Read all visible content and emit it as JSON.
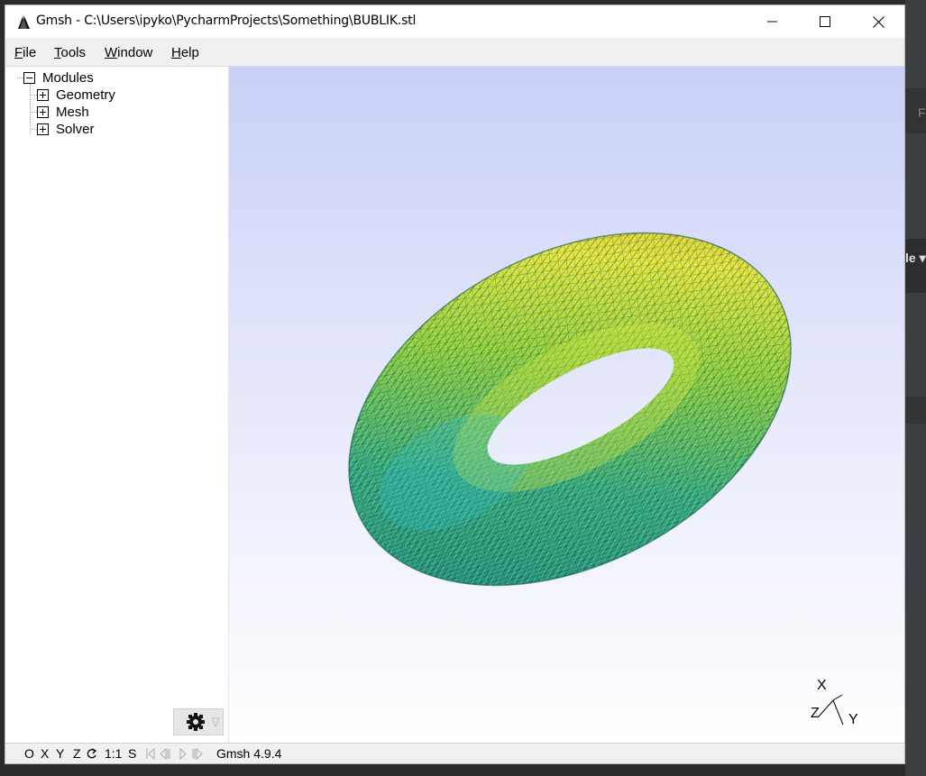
{
  "window": {
    "title": "Gmsh - C:\\Users\\ipyko\\PycharmProjects\\Something\\BUBLIK.stl",
    "icon": "gmsh-logo-icon"
  },
  "titlebar_buttons": {
    "minimize_icon": "minimize-icon",
    "maximize_icon": "maximize-icon",
    "close_icon": "close-icon"
  },
  "menu": [
    {
      "label": "File",
      "key": "F",
      "rest": "ile"
    },
    {
      "label": "Tools",
      "key": "T",
      "rest": "ools"
    },
    {
      "label": "Window",
      "key": "W",
      "rest": "indow"
    },
    {
      "label": "Help",
      "key": "H",
      "rest": "elp"
    }
  ],
  "tree": {
    "root": {
      "label": "Modules",
      "state": "expanded"
    },
    "children": [
      {
        "label": "Geometry",
        "state": "collapsed"
      },
      {
        "label": "Mesh",
        "state": "collapsed"
      },
      {
        "label": "Solver",
        "state": "collapsed"
      }
    ]
  },
  "graphics": {
    "model": "torus-mesh",
    "background_top": "#c9d0f7",
    "background_bottom": "#ffffff",
    "axes": {
      "x": "X",
      "y": "Y",
      "z": "Z"
    }
  },
  "statusbar": {
    "view_buttons": [
      "O",
      "X",
      "Y",
      "Z"
    ],
    "rotate_icon": "rotate-icon",
    "scale_label": "1:1",
    "s_label": "S",
    "playback_icons": [
      "first-frame-icon",
      "previous-frame-icon",
      "play-icon",
      "next-frame-icon"
    ],
    "version": "Gmsh 4.9.4"
  },
  "colors": {
    "mesh_teal": "#1a9a8a",
    "mesh_green": "#5cc040",
    "mesh_yellow": "#e8e830",
    "mesh_orange": "#d88a10",
    "mesh_cyan": "#30c0d8"
  },
  "background_app": {
    "peek_text_1": "F",
    "peek_text_2": "le ▾"
  }
}
